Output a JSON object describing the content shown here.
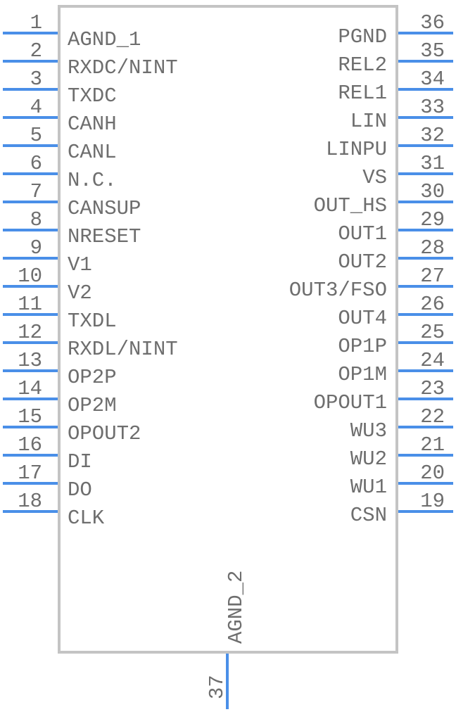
{
  "component": {
    "left_pins": [
      {
        "number": "1",
        "name": "AGND_1"
      },
      {
        "number": "2",
        "name": "RXDC/NINT"
      },
      {
        "number": "3",
        "name": "TXDC"
      },
      {
        "number": "4",
        "name": "CANH"
      },
      {
        "number": "5",
        "name": "CANL"
      },
      {
        "number": "6",
        "name": "N.C."
      },
      {
        "number": "7",
        "name": "CANSUP"
      },
      {
        "number": "8",
        "name": "NRESET"
      },
      {
        "number": "9",
        "name": "V1"
      },
      {
        "number": "10",
        "name": "V2"
      },
      {
        "number": "11",
        "name": "TXDL"
      },
      {
        "number": "12",
        "name": "RXDL/NINT"
      },
      {
        "number": "13",
        "name": "OP2P"
      },
      {
        "number": "14",
        "name": "OP2M"
      },
      {
        "number": "15",
        "name": "OPOUT2"
      },
      {
        "number": "16",
        "name": "DI"
      },
      {
        "number": "17",
        "name": "DO"
      },
      {
        "number": "18",
        "name": "CLK"
      }
    ],
    "right_pins": [
      {
        "number": "36",
        "name": "PGND"
      },
      {
        "number": "35",
        "name": "REL2"
      },
      {
        "number": "34",
        "name": "REL1"
      },
      {
        "number": "33",
        "name": "LIN"
      },
      {
        "number": "32",
        "name": "LINPU"
      },
      {
        "number": "31",
        "name": "VS"
      },
      {
        "number": "30",
        "name": "OUT_HS"
      },
      {
        "number": "29",
        "name": "OUT1"
      },
      {
        "number": "28",
        "name": "OUT2"
      },
      {
        "number": "27",
        "name": "OUT3/FSO"
      },
      {
        "number": "26",
        "name": "OUT4"
      },
      {
        "number": "25",
        "name": "OP1P"
      },
      {
        "number": "24",
        "name": "OP1M"
      },
      {
        "number": "23",
        "name": "OPOUT1"
      },
      {
        "number": "22",
        "name": "WU3"
      },
      {
        "number": "21",
        "name": "WU2"
      },
      {
        "number": "20",
        "name": "WU1"
      },
      {
        "number": "19",
        "name": "CSN"
      }
    ],
    "bottom_pins": [
      {
        "number": "37",
        "name": "AGND_2"
      }
    ]
  },
  "colors": {
    "pin": "#4a8fe8",
    "outline": "#c4c4c4",
    "text": "#6e6e6e"
  }
}
